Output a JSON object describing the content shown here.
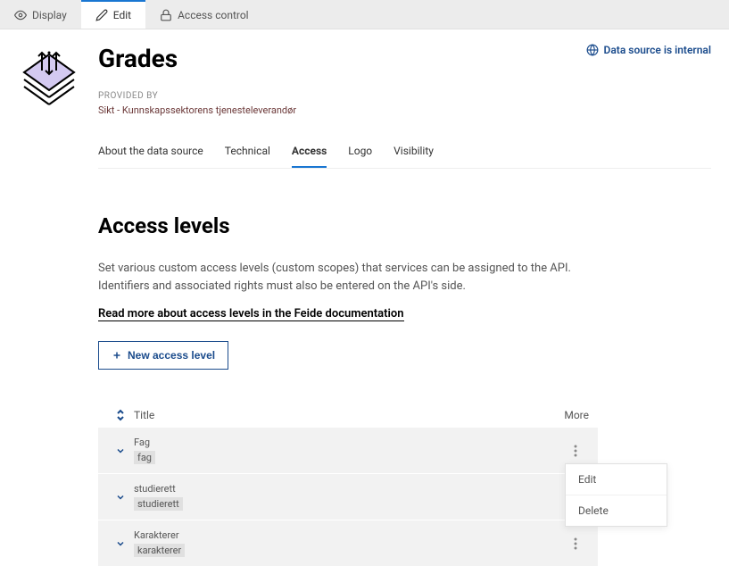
{
  "top_tabs": {
    "display": "Display",
    "edit": "Edit",
    "access_control": "Access control"
  },
  "header": {
    "title": "Grades",
    "badge": "Data source is internal",
    "provided_by_label": "PROVIDED BY",
    "provider": "Sikt - Kunnskapssektorens tjenesteleverandør"
  },
  "secondary_tabs": {
    "about": "About the data source",
    "technical": "Technical",
    "access": "Access",
    "logo": "Logo",
    "visibility": "Visibility"
  },
  "section": {
    "title": "Access levels",
    "description": "Set various custom access levels (custom scopes) that services can be assigned to the API. Identifiers and associated rights must also be entered on the API's side.",
    "read_more": "Read more about access levels in the Feide documentation",
    "new_button": "New access level"
  },
  "table": {
    "head_title": "Title",
    "head_more": "More",
    "rows": [
      {
        "title": "Fag",
        "code": "fag"
      },
      {
        "title": "studierett",
        "code": "studierett"
      },
      {
        "title": "Karakterer",
        "code": "karakterer"
      }
    ]
  },
  "dropdown": {
    "edit": "Edit",
    "delete": "Delete"
  }
}
